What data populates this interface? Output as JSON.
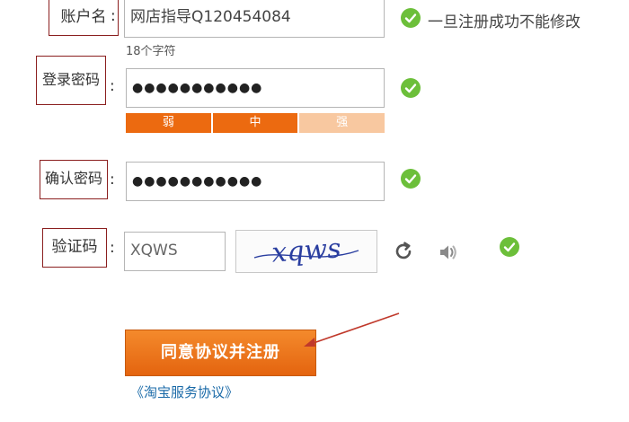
{
  "form": {
    "account": {
      "label": "账户名",
      "colon": ":",
      "value": "网店指导Q120454084",
      "char_count": "18个字符",
      "hint": "一旦注册成功不能修改"
    },
    "password": {
      "label": "登录密码",
      "colon": ":",
      "value": "●●●●●●●●●●●",
      "strength": {
        "weak": "弱",
        "medium": "中",
        "strong": "强"
      }
    },
    "confirm_password": {
      "label": "确认密码",
      "colon": ":",
      "value": "●●●●●●●●●●●"
    },
    "captcha": {
      "label": "验证码",
      "colon": ":",
      "value": "XQWS",
      "image_text": "xqws"
    }
  },
  "register_button": "同意协议并注册",
  "agreement_link": "《淘宝服务协议》",
  "colors": {
    "accent": "#ec6a10",
    "success": "#6cbf3a",
    "label_border": "#8b1f1f",
    "link": "#1a6aa8",
    "arrow": "#c0392b"
  },
  "icons": [
    "checkmark-icon",
    "refresh-icon",
    "speaker-icon",
    "annotation-arrow-icon"
  ]
}
